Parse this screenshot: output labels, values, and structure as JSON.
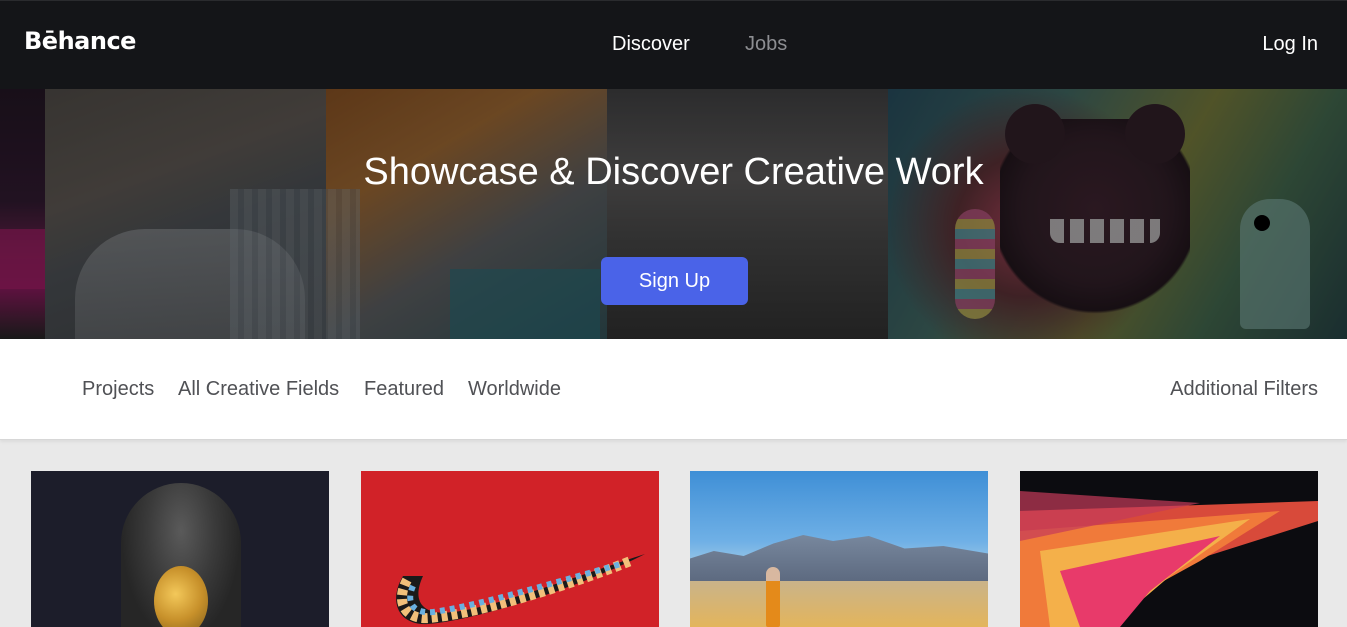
{
  "header": {
    "logo": "Bēhance",
    "nav": {
      "discover": "Discover",
      "jobs": "Jobs"
    },
    "login": "Log In"
  },
  "hero": {
    "title": "Showcase & Discover Creative Work",
    "cta": "Sign Up",
    "cta_color": "#4a63e8"
  },
  "filters": {
    "items": [
      "Projects",
      "All Creative Fields",
      "Featured",
      "Worldwide"
    ],
    "additional": "Additional Filters"
  },
  "gallery": {
    "cards": [
      {
        "name": "bronze-penguin-sculpture"
      },
      {
        "name": "nike-swoosh-characters"
      },
      {
        "name": "desert-figure-orange-dress"
      },
      {
        "name": "abstract-red-splash"
      }
    ]
  },
  "colors": {
    "header_bg": "#141518",
    "page_bg": "#e9e9e9",
    "accent": "#4a63e8"
  }
}
